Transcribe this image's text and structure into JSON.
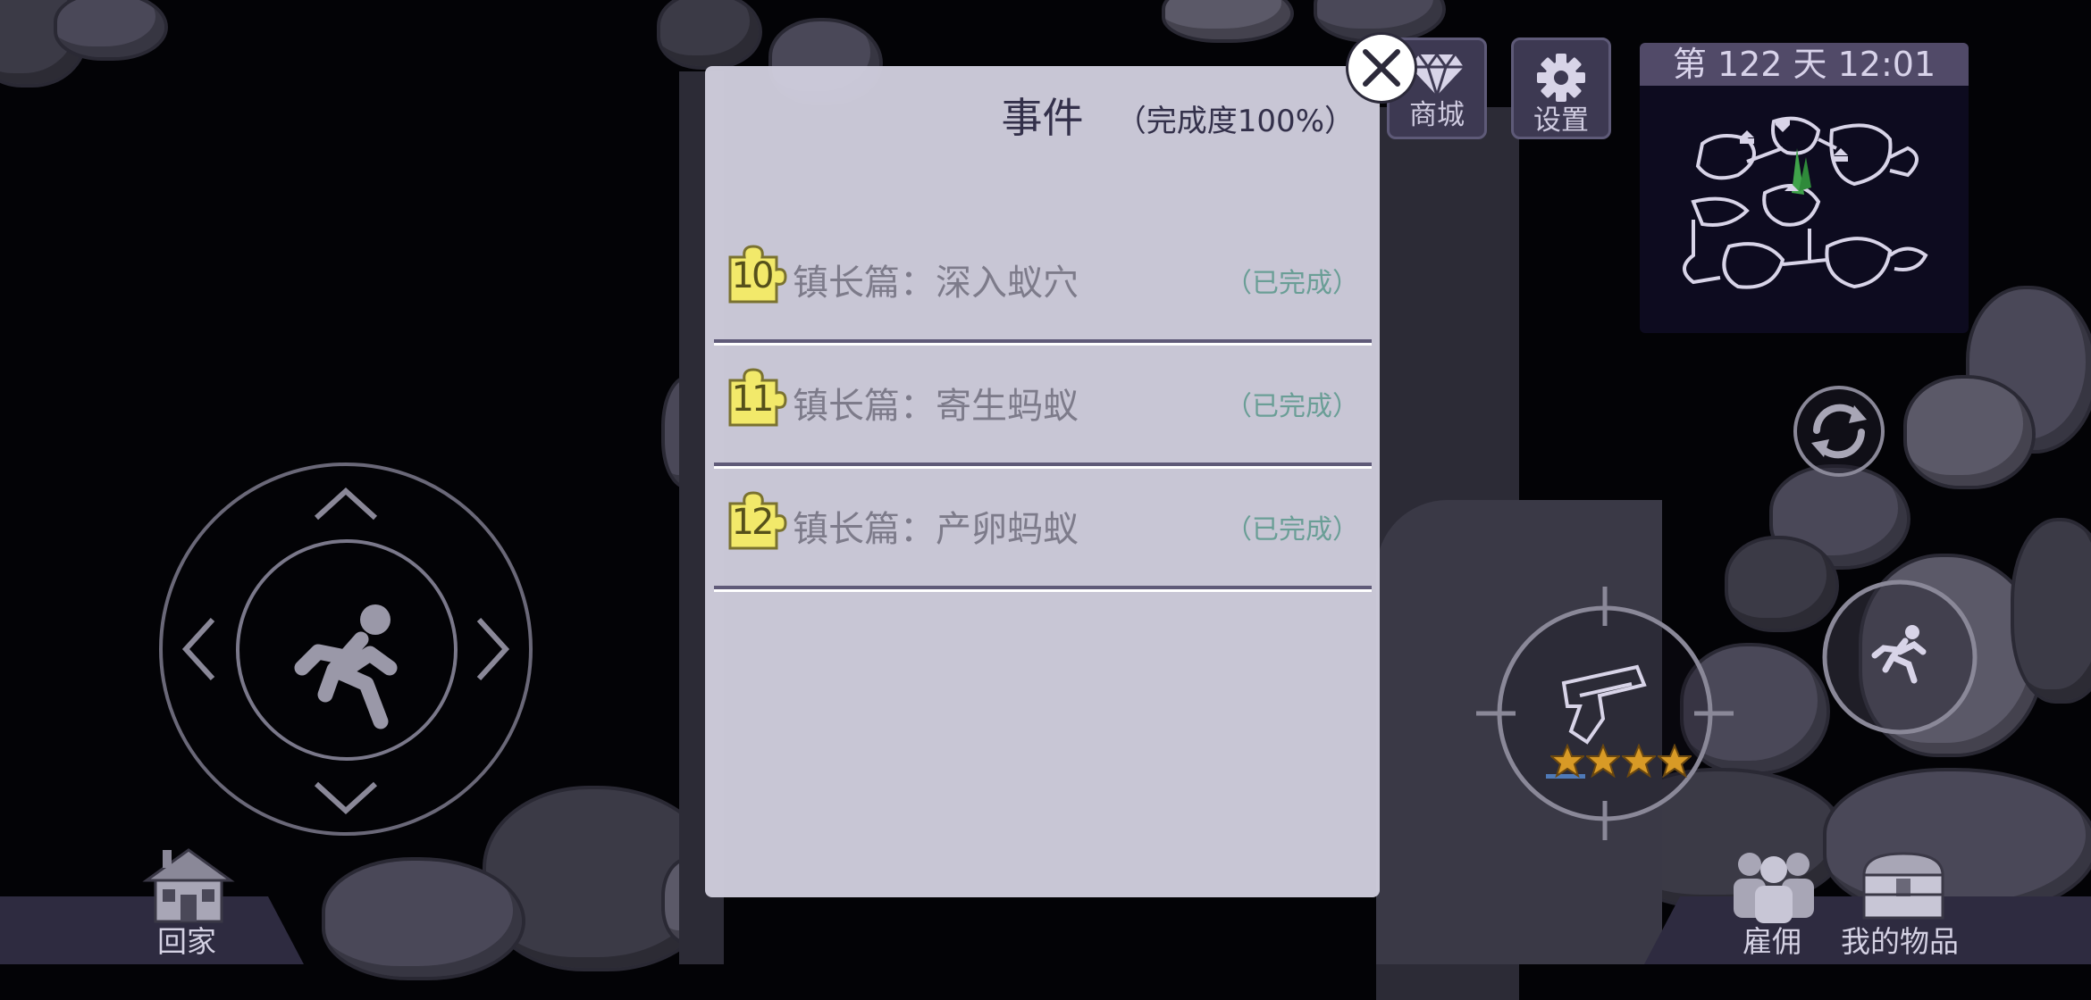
{
  "header": {
    "shop_label": "商城",
    "settings_label": "设置",
    "day_clock": "第 122 天   12:01"
  },
  "event_panel": {
    "title": "事件",
    "progress": "（完成度100%）",
    "events": [
      {
        "number": "10",
        "name": "镇长篇：深入蚁穴",
        "status": "（已完成）"
      },
      {
        "number": "11",
        "name": "镇长篇：寄生蚂蚁",
        "status": "（已完成）"
      },
      {
        "number": "12",
        "name": "镇长篇：产卵蚂蚁",
        "status": "（已完成）"
      }
    ],
    "badge_color": "#f2e96a",
    "status_color": "#6a9e96"
  },
  "bottom_bar": {
    "home_label": "回家",
    "hire_label": "雇佣",
    "items_label": "我的物品"
  },
  "weapon": {
    "stars": 4,
    "max_stars": 4
  },
  "icons": [
    "diamond-icon",
    "gear-icon",
    "close-icon",
    "running-man-icon",
    "house-icon",
    "crosshair-icon",
    "pistol-icon",
    "star-icon",
    "refresh-icon",
    "sprint-icon",
    "people-icon",
    "chest-icon",
    "puzzle-piece-icon",
    "chevron-up-icon",
    "chevron-down-icon",
    "chevron-left-icon",
    "chevron-right-icon"
  ]
}
